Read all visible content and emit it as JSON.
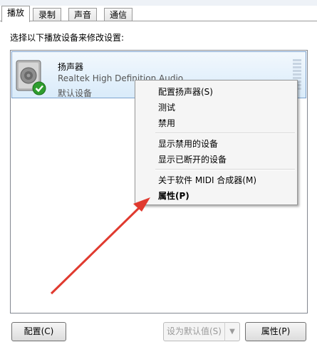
{
  "tabs": [
    {
      "label": "播放"
    },
    {
      "label": "录制"
    },
    {
      "label": "声音"
    },
    {
      "label": "通信"
    }
  ],
  "instruction": "选择以下播放设备来修改设置:",
  "device": {
    "name": "扬声器",
    "driver": "Realtek High Definition Audio",
    "status": "默认设备",
    "icon": "speaker-icon",
    "badge_icon": "checkmark-icon"
  },
  "context_menu": {
    "items": [
      {
        "label": "配置扬声器(S)"
      },
      {
        "label": "测试"
      },
      {
        "label": "禁用"
      },
      {
        "label": "显示禁用的设备"
      },
      {
        "label": "显示已断开的设备"
      },
      {
        "label": "关于软件 MIDI 合成器(M)"
      },
      {
        "label": "属性(P)"
      }
    ]
  },
  "buttons": {
    "configure": "配置(C)",
    "set_default": "设为默认值(S)",
    "properties": "属性(P)"
  },
  "colors": {
    "annotation_arrow": "#e03a2f",
    "selection_border": "#7da2ce",
    "check_badge": "#2e9d2e"
  }
}
